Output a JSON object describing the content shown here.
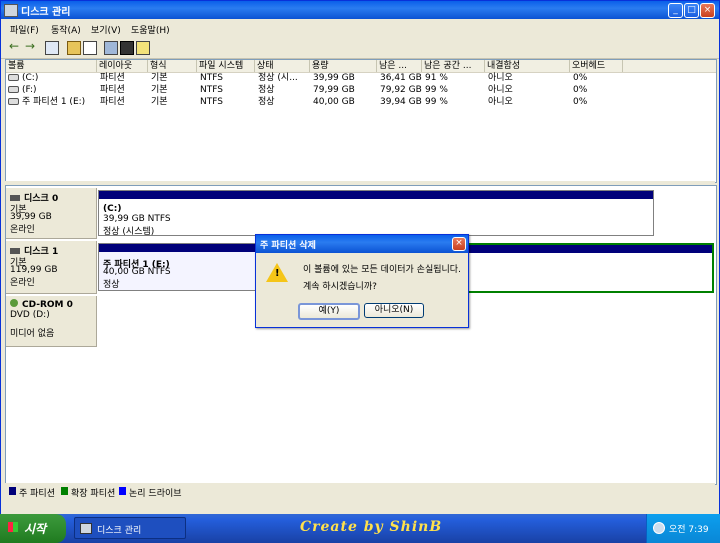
{
  "window": {
    "title": "디스크 관리"
  },
  "menu": [
    "파일(F)",
    "동작(A)",
    "보기(V)",
    "도움말(H)"
  ],
  "toolbar": {
    "icons": [
      "back-arrow-icon",
      "forward-arrow-icon",
      "properties-icon",
      "help-icon",
      "refresh-icon",
      "rescan-icon",
      "disk-icon",
      "list-icon"
    ]
  },
  "list": {
    "columns": [
      "볼륨",
      "레이아웃",
      "형식",
      "파일 시스템",
      "상태",
      "용량",
      "남은 ...",
      "남은 공간 ...",
      "내결함성",
      "오버헤드"
    ],
    "rows": [
      [
        "(C:)",
        "파티션",
        "기본",
        "NTFS",
        "정상 (시...",
        "39,99 GB",
        "36,41 GB",
        "91 %",
        "아니오",
        "0%"
      ],
      [
        "(F:)",
        "파티션",
        "기본",
        "NTFS",
        "정상",
        "79,99 GB",
        "79,92 GB",
        "99 %",
        "아니오",
        "0%"
      ],
      [
        "주 파티션 1 (E:)",
        "파티션",
        "기본",
        "NTFS",
        "정상",
        "40,00 GB",
        "39,94 GB",
        "99 %",
        "아니오",
        "0%"
      ]
    ]
  },
  "disks": [
    {
      "name": "디스크 0",
      "type": "기본",
      "size": "39,99 GB",
      "status": "온라인",
      "volume": {
        "label": "(C:)",
        "size": "39,99 GB NTFS",
        "status": "정상 (시스템)"
      }
    },
    {
      "name": "디스크 1",
      "type": "기본",
      "size": "119,99 GB",
      "status": "온라인",
      "volume": {
        "label": "주 파티션 1  (E:)",
        "size": "40,00 GB NTFS",
        "status": "정상"
      }
    },
    {
      "name": "CD-ROM 0",
      "type": "DVD (D:)",
      "size": "",
      "status": "미디어 없음"
    }
  ],
  "legend": [
    {
      "label": "주 파티션",
      "color": "#00007a"
    },
    {
      "label": "확장 파티션",
      "color": "#008000"
    },
    {
      "label": "논리 드라이브",
      "color": "#0000ff"
    }
  ],
  "dialog": {
    "title": "주 파티션 삭제",
    "message": "이 볼륨에 있는 모든 데이터가 손실됩니다.",
    "question": "계속 하시겠습니까?",
    "yes": "예(Y)",
    "no": "아니오(N)"
  },
  "taskbar": {
    "start": "시작",
    "task": "디스크 관리",
    "credit": "Create by ShinB",
    "clock": "오전 7:39"
  }
}
